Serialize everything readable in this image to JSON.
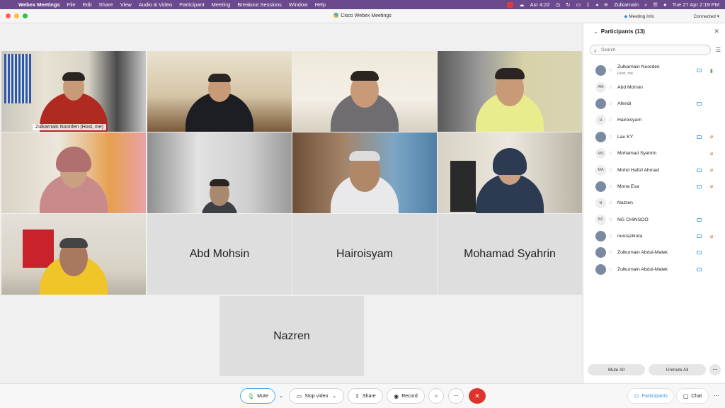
{
  "menubar": {
    "app": "Webex Meetings",
    "items": [
      "File",
      "Edit",
      "Share",
      "View",
      "Audio & Video",
      "Participant",
      "Meeting",
      "Breakout Sessions",
      "Window",
      "Help"
    ],
    "prayer": "Asr 4:22",
    "user": "Zulkarnain",
    "datetime": "Tue 27 Apr  2:19 PM"
  },
  "window": {
    "title": "Cisco Webex Meetings",
    "meeting_info": "Meeting Info",
    "status": "Connected"
  },
  "tiles": [
    {
      "label": "Zulkarnain Noorden  (Host, me)"
    },
    {
      "name": "Abd Mohsin"
    },
    {
      "name": "Hairoisyam"
    },
    {
      "name": "Mohamad Syahrin"
    },
    {
      "name": "Nazren"
    }
  ],
  "panel": {
    "title": "Participants (13)",
    "search_placeholder": "Search",
    "mute_all": "Mute All",
    "unmute_all": "Unmute All",
    "participants": [
      {
        "name": "Zulkarnain Noorden",
        "sub": "Host, me",
        "avatar": "",
        "cam": true,
        "mic": "green"
      },
      {
        "name": "Abd Mohsin",
        "avatar": "AM",
        "cam": false,
        "mic": ""
      },
      {
        "name": "Afendi",
        "avatar": "",
        "cam": true,
        "mic": ""
      },
      {
        "name": "Hairoisyam",
        "avatar": "H",
        "cam": false,
        "mic": ""
      },
      {
        "name": "Lau KY",
        "avatar": "",
        "cam": true,
        "mic": "muted"
      },
      {
        "name": "Mohamad Syahrin",
        "avatar": "MS",
        "cam": false,
        "mic": "muted"
      },
      {
        "name": "Mohd Hafizl Ahmad",
        "avatar": "MA",
        "cam": true,
        "mic": "muted"
      },
      {
        "name": "Mona Esa",
        "avatar": "",
        "cam": true,
        "mic": "muted"
      },
      {
        "name": "Nazren",
        "avatar": "N",
        "cam": false,
        "mic": ""
      },
      {
        "name": "NG CHINSOO",
        "avatar": "NC",
        "cam": true,
        "mic": ""
      },
      {
        "name": "noorazlinda",
        "avatar": "",
        "cam": true,
        "mic": "muted"
      },
      {
        "name": "Zulkurnain Abdul-Malek",
        "avatar": "",
        "cam": true,
        "mic": ""
      },
      {
        "name": "Zulkurnain Abdul-Malek",
        "avatar": "",
        "cam": true,
        "mic": ""
      }
    ]
  },
  "toolbar": {
    "mute": "Mute",
    "stop_video": "Stop video",
    "share": "Share",
    "record": "Record",
    "participants": "Participants",
    "chat": "Chat"
  }
}
